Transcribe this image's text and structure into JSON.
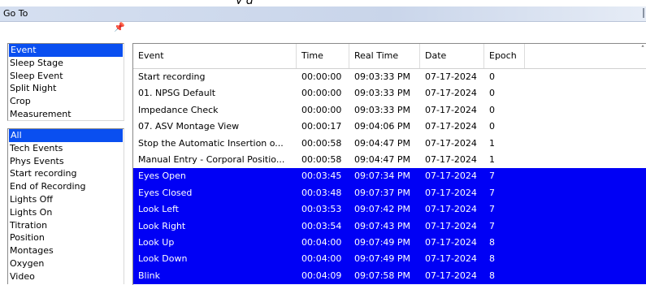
{
  "top_fragment": "y g",
  "window": {
    "title": "Go To"
  },
  "category_list": [
    "Event",
    "Sleep Stage",
    "Sleep Event",
    "Split Night",
    "Crop",
    "Measurement"
  ],
  "category_selected": 0,
  "filter_list": [
    "All",
    "Tech Events",
    "Phys Events",
    "Start recording",
    "End of Recording",
    "Lights Off",
    "Lights On",
    "Titration",
    "Position",
    "Montages",
    "Oxygen",
    "Video"
  ],
  "filter_selected": 0,
  "table": {
    "headers": [
      "Event",
      "Time",
      "Real Time",
      "Date",
      "Epoch"
    ],
    "rows": [
      {
        "cells": [
          "Start recording",
          "00:00:00",
          "09:03:33 PM",
          "07-17-2024",
          "0"
        ],
        "selected": false
      },
      {
        "cells": [
          "01. NPSG Default",
          "00:00:00",
          "09:03:33 PM",
          "07-17-2024",
          "0"
        ],
        "selected": false
      },
      {
        "cells": [
          "Impedance Check",
          "00:00:00",
          "09:03:33 PM",
          "07-17-2024",
          "0"
        ],
        "selected": false
      },
      {
        "cells": [
          "07. ASV Montage View",
          "00:00:17",
          "09:04:06 PM",
          "07-17-2024",
          "0"
        ],
        "selected": false
      },
      {
        "cells": [
          "Stop the Automatic Insertion o...",
          "00:00:58",
          "09:04:47 PM",
          "07-17-2024",
          "1"
        ],
        "selected": false
      },
      {
        "cells": [
          "Manual Entry - Corporal Positio...",
          "00:00:58",
          "09:04:47 PM",
          "07-17-2024",
          "1"
        ],
        "selected": false
      },
      {
        "cells": [
          "Eyes Open",
          "00:03:45",
          "09:07:34 PM",
          "07-17-2024",
          "7"
        ],
        "selected": true
      },
      {
        "cells": [
          "Eyes Closed",
          "00:03:48",
          "09:07:37 PM",
          "07-17-2024",
          "7"
        ],
        "selected": true
      },
      {
        "cells": [
          "Look Left",
          "00:03:53",
          "09:07:42 PM",
          "07-17-2024",
          "7"
        ],
        "selected": true
      },
      {
        "cells": [
          "Look Right",
          "00:03:54",
          "09:07:43 PM",
          "07-17-2024",
          "7"
        ],
        "selected": true
      },
      {
        "cells": [
          "Look Up",
          "00:04:00",
          "09:07:49 PM",
          "07-17-2024",
          "8"
        ],
        "selected": true
      },
      {
        "cells": [
          "Look Down",
          "00:04:00",
          "09:07:49 PM",
          "07-17-2024",
          "8"
        ],
        "selected": true
      },
      {
        "cells": [
          "Blink",
          "00:04:09",
          "09:07:58 PM",
          "07-17-2024",
          "8"
        ],
        "selected": true
      }
    ]
  },
  "icons": {
    "pin": "pin-icon",
    "scroll_up": "scroll-up-arrow-icon"
  }
}
